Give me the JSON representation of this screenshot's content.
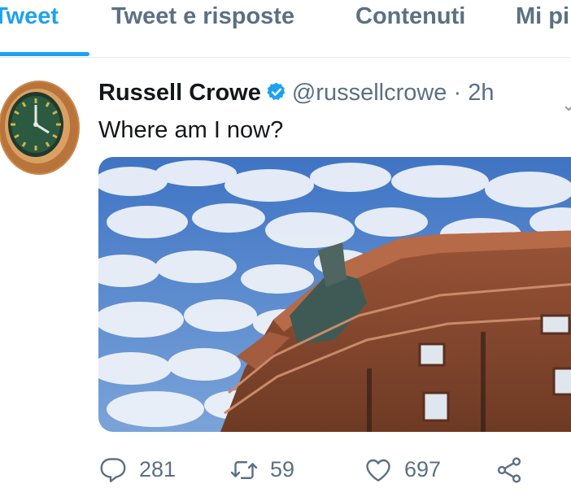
{
  "tabs": [
    {
      "label": "Tweet",
      "active": true
    },
    {
      "label": "Tweet e risposte",
      "active": false
    },
    {
      "label": "Contenuti",
      "active": false
    },
    {
      "label": "Mi pi",
      "active": false
    }
  ],
  "tweet": {
    "author_name": "Russell Crowe",
    "handle": "@russellcrowe",
    "separator": "·",
    "time": "2h",
    "text": "Where am I now?",
    "verified": true
  },
  "actions": {
    "replies": "281",
    "retweets": "59",
    "likes": "697"
  },
  "colors": {
    "accent": "#1da1f2",
    "secondary_text": "#5b7083",
    "primary_text": "#14171a"
  },
  "icons": [
    "clock-avatar-icon",
    "verified-badge-icon",
    "chevron-down-icon",
    "reply-icon",
    "retweet-icon",
    "like-icon",
    "share-icon"
  ]
}
